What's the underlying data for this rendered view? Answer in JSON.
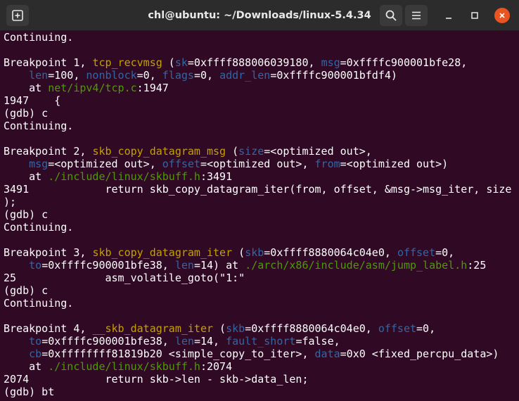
{
  "window": {
    "title": "chl@ubuntu: ~/Downloads/linux-5.4.34",
    "close_color": "#e95420"
  },
  "icons": {
    "new_tab": "new-tab-icon",
    "search": "search-icon",
    "menu": "hamburger-menu-icon",
    "minimize": "minimize-icon",
    "maximize": "maximize-icon",
    "close": "close-icon"
  },
  "terminal": {
    "colors": {
      "background": "#300a24",
      "text": "#ffffff",
      "function": "#c4a000",
      "argument": "#3465a4",
      "path": "#4e9a06"
    },
    "lines": [
      [
        {
          "t": "Continuing."
        }
      ],
      [],
      [
        {
          "t": "Breakpoint 1, "
        },
        {
          "t": "tcp_recvmsg",
          "c": "fn"
        },
        {
          "t": " ("
        },
        {
          "t": "sk",
          "c": "arg"
        },
        {
          "t": "=0xffff888006039180, "
        },
        {
          "t": "msg",
          "c": "arg"
        },
        {
          "t": "=0xffffc900001bfe28,"
        }
      ],
      [
        {
          "t": "    "
        },
        {
          "t": "len",
          "c": "arg"
        },
        {
          "t": "=100, "
        },
        {
          "t": "nonblock",
          "c": "arg"
        },
        {
          "t": "=0, "
        },
        {
          "t": "flags",
          "c": "arg"
        },
        {
          "t": "=0, "
        },
        {
          "t": "addr_len",
          "c": "arg"
        },
        {
          "t": "=0xffffc900001bfdf4)"
        }
      ],
      [
        {
          "t": "    at "
        },
        {
          "t": "net/ipv4/tcp.c",
          "c": "path"
        },
        {
          "t": ":1947"
        }
      ],
      [
        {
          "t": "1947    {"
        }
      ],
      [
        {
          "t": "(gdb) c"
        }
      ],
      [
        {
          "t": "Continuing."
        }
      ],
      [],
      [
        {
          "t": "Breakpoint 2, "
        },
        {
          "t": "skb_copy_datagram_msg",
          "c": "fn"
        },
        {
          "t": " ("
        },
        {
          "t": "size",
          "c": "arg"
        },
        {
          "t": "=<optimized out>,"
        }
      ],
      [
        {
          "t": "    "
        },
        {
          "t": "msg",
          "c": "arg"
        },
        {
          "t": "=<optimized out>, "
        },
        {
          "t": "offset",
          "c": "arg"
        },
        {
          "t": "=<optimized out>, "
        },
        {
          "t": "from",
          "c": "arg"
        },
        {
          "t": "=<optimized out>)"
        }
      ],
      [
        {
          "t": "    at "
        },
        {
          "t": "./include/linux/skbuff.h",
          "c": "path"
        },
        {
          "t": ":3491"
        }
      ],
      [
        {
          "t": "3491            return skb_copy_datagram_iter(from, offset, &msg->msg_iter, size"
        }
      ],
      [
        {
          "t": ");"
        }
      ],
      [
        {
          "t": "(gdb) c"
        }
      ],
      [
        {
          "t": "Continuing."
        }
      ],
      [],
      [
        {
          "t": "Breakpoint 3, "
        },
        {
          "t": "skb_copy_datagram_iter",
          "c": "fn"
        },
        {
          "t": " ("
        },
        {
          "t": "skb",
          "c": "arg"
        },
        {
          "t": "=0xffff8880064c04e0, "
        },
        {
          "t": "offset",
          "c": "arg"
        },
        {
          "t": "=0,"
        }
      ],
      [
        {
          "t": "    "
        },
        {
          "t": "to",
          "c": "arg"
        },
        {
          "t": "=0xffffc900001bfe38, "
        },
        {
          "t": "len",
          "c": "arg"
        },
        {
          "t": "=14) at "
        },
        {
          "t": "./arch/x86/include/asm/jump_label.h",
          "c": "path"
        },
        {
          "t": ":25"
        }
      ],
      [
        {
          "t": "25              asm_volatile_goto(\"1:\""
        }
      ],
      [
        {
          "t": "(gdb) c"
        }
      ],
      [
        {
          "t": "Continuing."
        }
      ],
      [],
      [
        {
          "t": "Breakpoint 4, "
        },
        {
          "t": "__skb_datagram_iter",
          "c": "fn"
        },
        {
          "t": " ("
        },
        {
          "t": "skb",
          "c": "arg"
        },
        {
          "t": "=0xffff8880064c04e0, "
        },
        {
          "t": "offset",
          "c": "arg"
        },
        {
          "t": "=0,"
        }
      ],
      [
        {
          "t": "    "
        },
        {
          "t": "to",
          "c": "arg"
        },
        {
          "t": "=0xffffc900001bfe38, "
        },
        {
          "t": "len",
          "c": "arg"
        },
        {
          "t": "=14, "
        },
        {
          "t": "fault_short",
          "c": "arg"
        },
        {
          "t": "=false,"
        }
      ],
      [
        {
          "t": "    "
        },
        {
          "t": "cb",
          "c": "arg"
        },
        {
          "t": "=0xffffffff81819b20 <simple_copy_to_iter>, "
        },
        {
          "t": "data",
          "c": "arg"
        },
        {
          "t": "=0x0 <fixed_percpu_data>)"
        }
      ],
      [
        {
          "t": "    at "
        },
        {
          "t": "./include/linux/skbuff.h",
          "c": "path"
        },
        {
          "t": ":2074"
        }
      ],
      [
        {
          "t": "2074            return skb->len - skb->data_len;"
        }
      ],
      [
        {
          "t": "(gdb) bt"
        }
      ]
    ]
  }
}
